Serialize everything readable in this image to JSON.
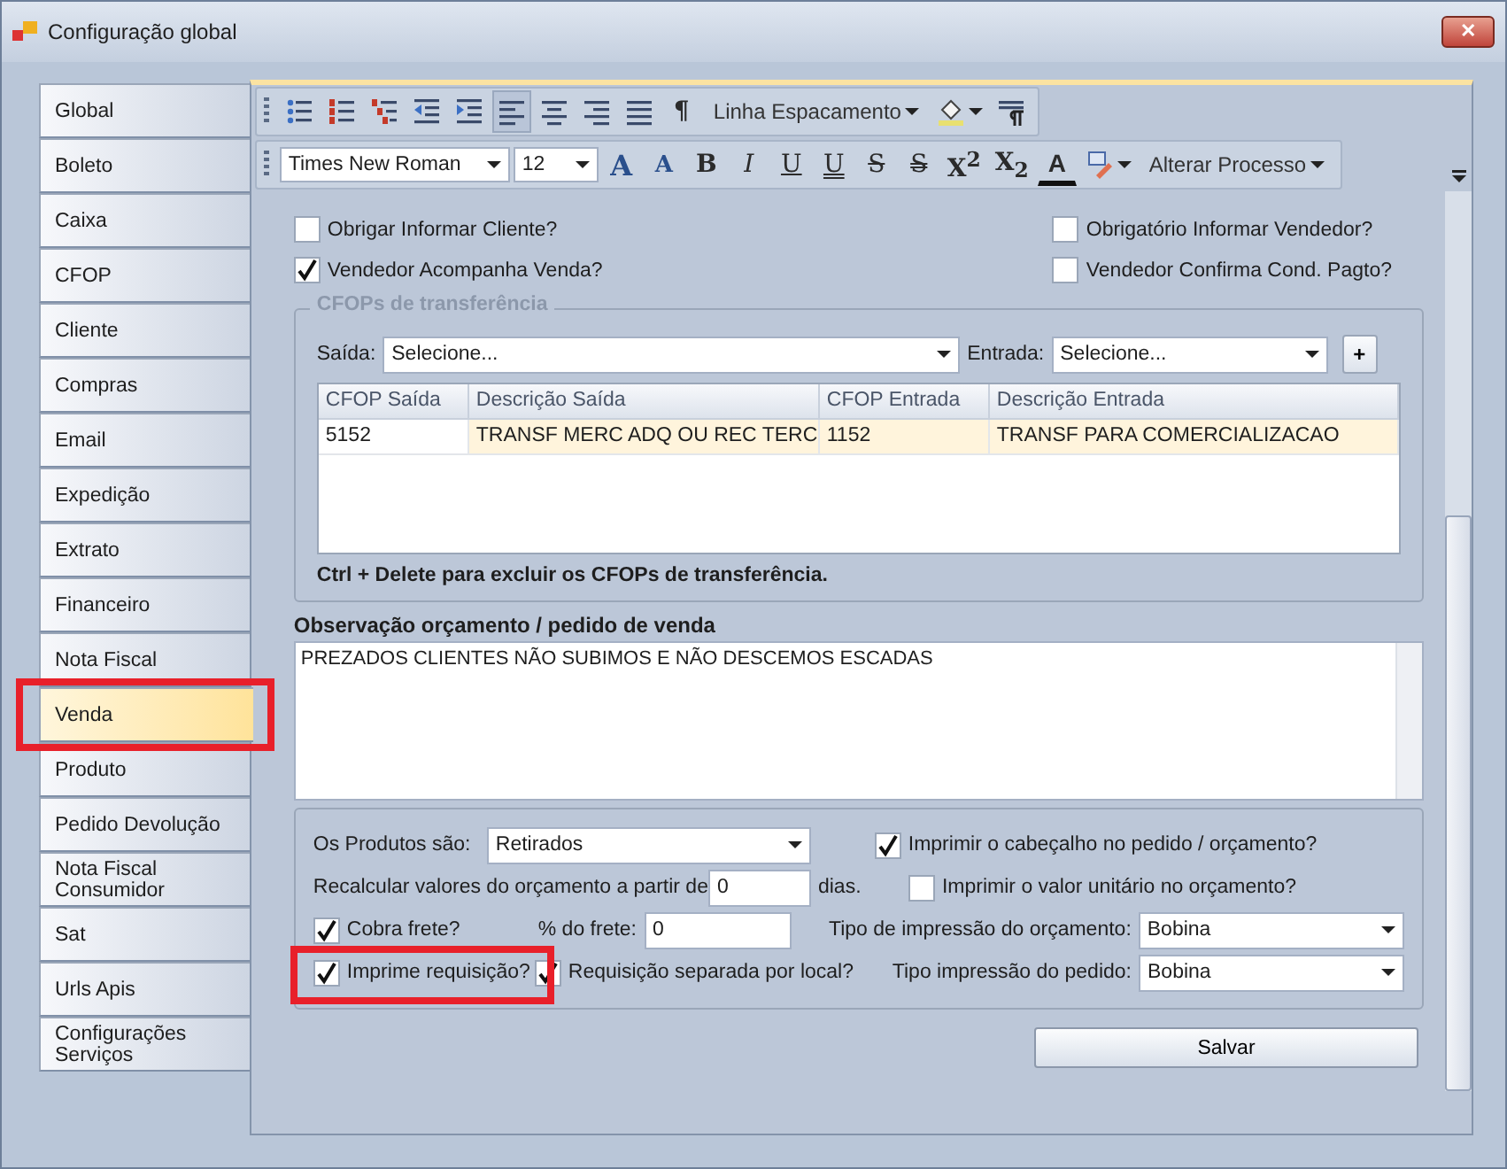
{
  "window": {
    "title": "Configuração global",
    "close": "✕"
  },
  "sidebar": {
    "items": [
      {
        "label": "Global",
        "selected": false,
        "highlighted": false
      },
      {
        "label": "Boleto",
        "selected": false,
        "highlighted": false
      },
      {
        "label": "Caixa",
        "selected": false,
        "highlighted": false
      },
      {
        "label": "CFOP",
        "selected": false,
        "highlighted": false
      },
      {
        "label": "Cliente",
        "selected": false,
        "highlighted": false
      },
      {
        "label": "Compras",
        "selected": false,
        "highlighted": false
      },
      {
        "label": "Email",
        "selected": false,
        "highlighted": false
      },
      {
        "label": "Expedição",
        "selected": false,
        "highlighted": false
      },
      {
        "label": "Extrato",
        "selected": false,
        "highlighted": false
      },
      {
        "label": "Financeiro",
        "selected": false,
        "highlighted": false
      },
      {
        "label": "Nota Fiscal",
        "selected": false,
        "highlighted": false
      },
      {
        "label": "Venda",
        "selected": true,
        "highlighted": true
      },
      {
        "label": "Produto",
        "selected": false,
        "highlighted": false
      },
      {
        "label": "Pedido Devolução",
        "selected": false,
        "highlighted": false
      },
      {
        "label": "Nota Fiscal Consumidor",
        "selected": false,
        "highlighted": false
      },
      {
        "label": "Sat",
        "selected": false,
        "highlighted": false
      },
      {
        "label": "Urls Apis",
        "selected": false,
        "highlighted": false
      },
      {
        "label": "Configurações Serviços",
        "selected": false,
        "highlighted": false
      }
    ]
  },
  "toolbar": {
    "row_1": [
      {
        "kind": "bullet-list",
        "selected": false
      },
      {
        "kind": "numbered-list",
        "selected": false
      },
      {
        "kind": "multilevel-list",
        "selected": false
      },
      {
        "kind": "outdent",
        "selected": false
      },
      {
        "kind": "indent",
        "selected": false
      },
      {
        "kind": "align-left",
        "selected": true
      },
      {
        "kind": "align-center",
        "selected": false
      },
      {
        "kind": "align-right",
        "selected": false
      },
      {
        "kind": "justify",
        "selected": false
      },
      {
        "kind": "glyph",
        "label": "¶",
        "selected": false
      },
      {
        "kind": "menu",
        "label": "Linha Espacamento",
        "selected": false
      },
      {
        "kind": "fill",
        "selected": false
      },
      {
        "kind": "paragraph-marks",
        "selected": false
      }
    ],
    "row_2": [
      {
        "kind": "combo",
        "label": "Times New Roman",
        "selected": false
      },
      {
        "kind": "size-combo",
        "label": "12",
        "selected": false
      },
      {
        "kind": "grow-font",
        "label": "A",
        "selected": false
      },
      {
        "kind": "shrink-font",
        "label": "A",
        "selected": false
      },
      {
        "kind": "bold",
        "label": "B",
        "selected": false
      },
      {
        "kind": "italic",
        "label": "I",
        "selected": false
      },
      {
        "kind": "underline",
        "label": "U",
        "selected": false
      },
      {
        "kind": "double-underline",
        "label": "U",
        "selected": false
      },
      {
        "kind": "strike",
        "label": "S",
        "selected": false
      },
      {
        "kind": "double-strike",
        "label": "S",
        "selected": false
      },
      {
        "kind": "script",
        "label": "X$^{2}$",
        "selected": false
      },
      {
        "kind": "script",
        "label": "X$_{2}$",
        "selected": false
      },
      {
        "kind": "font-color",
        "label": "A",
        "selected": false
      },
      {
        "kind": "highlight",
        "selected": false
      },
      {
        "kind": "menu",
        "label": "Alterar Processo",
        "selected": false
      }
    ]
  },
  "options": [
    {
      "label": "Obrigar Informar Cliente?",
      "checked": false
    },
    {
      "label": "Obrigatório Informar Vendedor?",
      "checked": false
    },
    {
      "label": "Vendedor Acompanha Venda?",
      "checked": true
    },
    {
      "label": "Vendedor Confirma Cond. Pagto?",
      "checked": false
    }
  ],
  "cfop_transfer": {
    "title": "CFOPs de transferência",
    "saida_label": "Saída:",
    "saida_value": "Selecione...",
    "entrada_label": "Entrada:",
    "entrada_value": "Selecione...",
    "add_button": "+",
    "columns": [
      "CFOP Saída",
      "Descrição Saída",
      "CFOP Entrada",
      "Descrição Entrada"
    ],
    "rows": [
      [
        "5152",
        "TRANSF MERC ADQ OU REC TERC",
        "1152",
        "TRANSF PARA COMERCIALIZACAO"
      ]
    ],
    "hint": "Ctrl + Delete para excluir os CFOPs de transferência."
  },
  "observation": {
    "label": "Observação orçamento / pedido de venda",
    "value": "PREZADOS CLIENTES NÃO SUBIMOS E NÃO DESCEMOS ESCADAS"
  },
  "sale_settings": {
    "products_label": "Os Produtos são:",
    "products_value": "Retirados",
    "print_header": {
      "label": "Imprimir o cabeçalho no pedido / orçamento?",
      "checked": true
    },
    "recalc_label": "Recalcular valores do orçamento a partir de",
    "recalc_value": "0",
    "recalc_unit": "dias.",
    "print_unit_price": {
      "label": "Imprimir o valor unitário no orçamento?",
      "checked": false
    },
    "charge_freight": {
      "label": "Cobra frete?",
      "checked": true
    },
    "freight_label": "% do frete:",
    "freight_value": "0",
    "quote_print_label": "Tipo de impressão do orçamento:",
    "quote_print_value": "Bobina",
    "print_request": {
      "label": "Imprime requisição?",
      "checked": true,
      "highlighted": true
    },
    "request_by_location": {
      "label": "Requisição separada por local?",
      "checked": true,
      "highlighted": false
    },
    "order_print_label": "Tipo impressão do pedido:",
    "order_print_value": "Bobina"
  },
  "save_button": "Salvar"
}
